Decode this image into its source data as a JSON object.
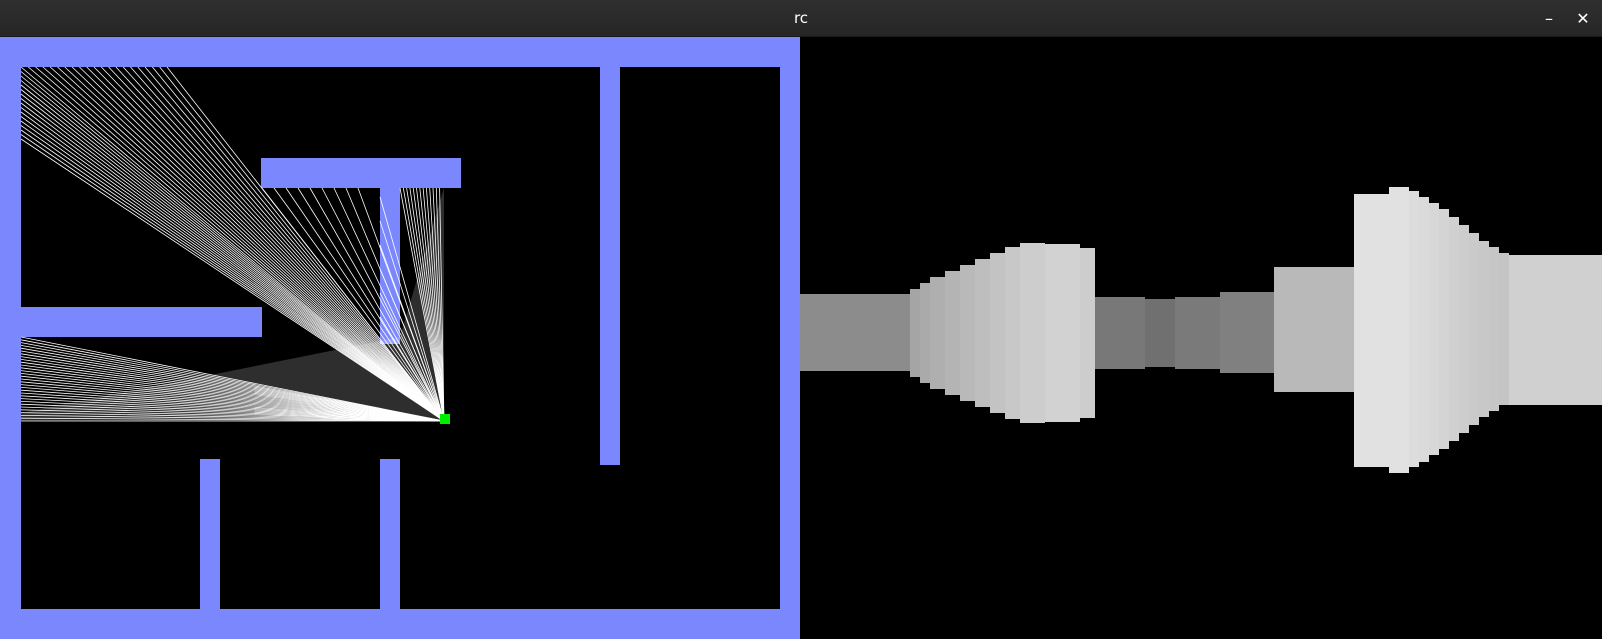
{
  "window": {
    "title": "rc",
    "minimize_glyph": "–",
    "close_glyph": "✕"
  },
  "colors": {
    "wall": "#7b87fd",
    "floor": "#000000",
    "ray": "#ffffff",
    "player": "#00ee00",
    "titlebar": "#2b2b2b"
  },
  "icons": {
    "minimize": "minimize-icon",
    "close": "close-icon"
  }
}
